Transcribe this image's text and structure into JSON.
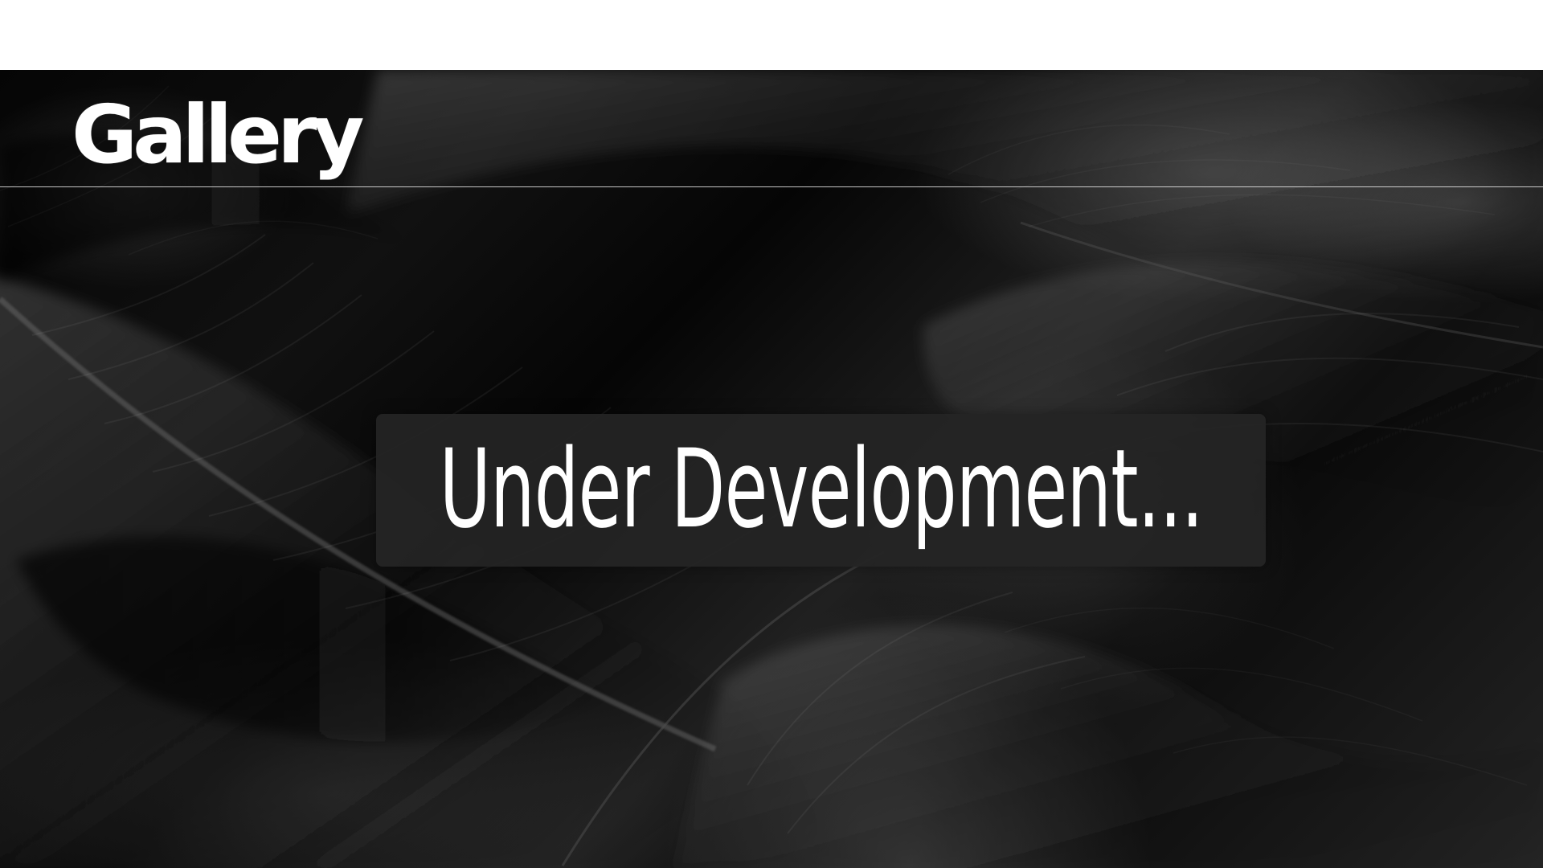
{
  "page": {
    "header": {
      "title": "Gallery"
    },
    "main": {
      "status_message": "Under Development..."
    },
    "background": {
      "subject": "black feathers",
      "dominant_colors": [
        "#050505",
        "#1a1a1a",
        "#777777"
      ]
    },
    "colors": {
      "top_bar": "#ffffff",
      "header_divider": "#e6e6e6",
      "status_panel": "#242424",
      "text": "#ffffff"
    }
  }
}
